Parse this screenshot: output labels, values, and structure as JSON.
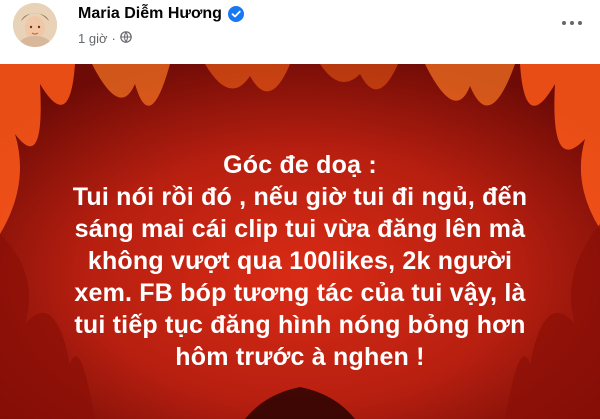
{
  "post": {
    "author_name": "Maria Diễm Hương",
    "time": "1 giờ",
    "verified_icon": "verified-badge-icon",
    "privacy_icon": "globe-icon",
    "more_icon": "more-horizontal-icon",
    "text_lines": [
      "Góc đe doạ :",
      "Tui nói rồi đó , nếu giờ tui đi ngủ, đến",
      "sáng mai cái clip tui vừa đăng lên mà",
      "không vượt qua 100likes, 2k người",
      "xem. FB bóp tương tác của tui vậy, là",
      "tui tiếp tục đăng hình nóng bỏng hơn",
      "hôm trước à nghen !"
    ]
  },
  "colors": {
    "verified": "#1877f2",
    "background_red": "#b81f10",
    "flame": "#ff6a1a"
  }
}
